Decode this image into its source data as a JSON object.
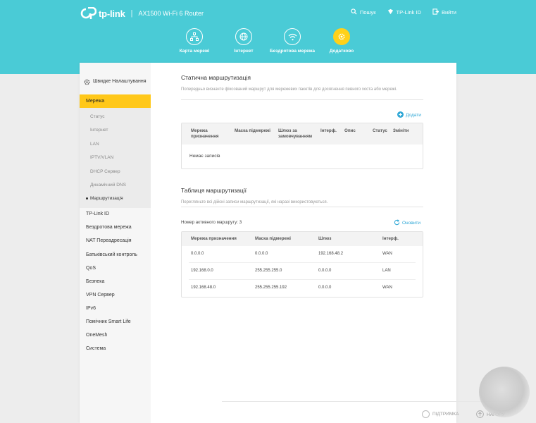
{
  "header": {
    "logo_text": "tp-link",
    "separator": "|",
    "model": "AX1500 Wi-Fi 6 Router",
    "search_label": "Пошук",
    "tplink_id_label": "TP-Link ID",
    "logout_label": "Вийти",
    "nav": [
      {
        "label": "Карта мережі",
        "icon": "network-map-icon"
      },
      {
        "label": "Інтернет",
        "icon": "globe-icon"
      },
      {
        "label": "Бездротова мережа",
        "icon": "wifi-icon"
      },
      {
        "label": "Додатково",
        "icon": "gear-icon",
        "active": true
      }
    ]
  },
  "sidebar": {
    "quick_setup": "Швидке Налаштування",
    "active_section": "Мережа",
    "sub_items": [
      "Статус",
      "Інтернет",
      "LAN",
      "IPTV/VLAN",
      "DHCP Сервер",
      "Динамічний DNS",
      "Маршрутизація"
    ],
    "active_sub": "Маршрутизація",
    "sections": [
      "TP-Link ID",
      "Бездротова мережа",
      "NAT Переадресація",
      "Батьківський контроль",
      "QoS",
      "Безпека",
      "VPN Сервер",
      "IPv6",
      "Помічник Smart Life",
      "OneMesh",
      "Система"
    ]
  },
  "static_routing": {
    "title": "Статична маршрутизація",
    "description": "Попередньо визначте фіксований маршрут для мережевих пакетів для досягнення певного хоста або мережі.",
    "add_label": "Додати",
    "columns": [
      "Мережа призначення",
      "Маска підмережі",
      "Шлюз за замовчуванням",
      "Інтерф.",
      "Опис",
      "Статус",
      "Змініти"
    ],
    "empty_text": "Немає записів"
  },
  "routing_table": {
    "title": "Таблиця маршрутизації",
    "description": "Перегляньте всі дійсні записи маршрутизації, які наразі використовуються.",
    "active_label": "Номер активного маршруту: 3",
    "refresh_label": "Оновити",
    "columns": [
      "Мережа призначення",
      "Маска підмережі",
      "Шлюз",
      "Інтерф."
    ],
    "rows": [
      [
        "0.0.0.0",
        "0.0.0.0",
        "192.168.48.2",
        "WAN"
      ],
      [
        "192.168.0.0",
        "255.255.255.0",
        "0.0.0.0",
        "LAN"
      ],
      [
        "192.168.48.0",
        "255.255.255.192",
        "0.0.0.0",
        "WAN"
      ]
    ]
  },
  "footer": {
    "support_label": "ПІДТРИМКА",
    "top_label": "НАГОРУ"
  },
  "colors": {
    "header": "#4acbd6",
    "accent": "#ffc81a",
    "link": "#2ea7d6"
  }
}
